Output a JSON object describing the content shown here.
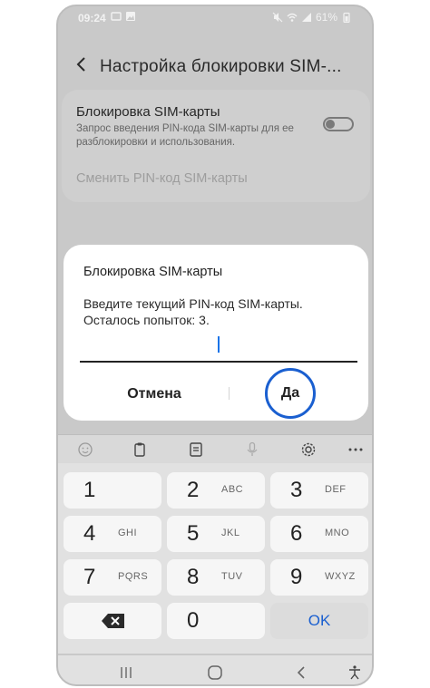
{
  "status_bar": {
    "time": "09:24",
    "battery": "61%"
  },
  "header": {
    "title": "Настройка блокировки SIM-..."
  },
  "settings": {
    "sim_lock_title": "Блокировка SIM-карты",
    "sim_lock_desc": "Запрос введения PIN-кода SIM-карты для ее разблокировки и использования.",
    "sim_lock_enabled": false,
    "change_pin_label": "Сменить PIN-код SIM-карты"
  },
  "dialog": {
    "title": "Блокировка SIM-карты",
    "message_line1": "Введите текущий PIN-код SIM-карты.",
    "message_line2": "Осталось попыток: 3.",
    "pin_value": "",
    "cancel_label": "Отмена",
    "confirm_label": "Да"
  },
  "keyboard": {
    "keys": [
      {
        "num": "1",
        "letters": ""
      },
      {
        "num": "2",
        "letters": "ABC"
      },
      {
        "num": "3",
        "letters": "DEF"
      },
      {
        "num": "4",
        "letters": "GHI"
      },
      {
        "num": "5",
        "letters": "JKL"
      },
      {
        "num": "6",
        "letters": "MNO"
      },
      {
        "num": "7",
        "letters": "PQRS"
      },
      {
        "num": "8",
        "letters": "TUV"
      },
      {
        "num": "9",
        "letters": "WXYZ"
      },
      {
        "num": "0",
        "letters": ""
      }
    ],
    "ok_label": "OK"
  },
  "colors": {
    "accent": "#1a5fd0",
    "dim_overlay": "#c9c9c9",
    "caret": "#1a73e8"
  }
}
